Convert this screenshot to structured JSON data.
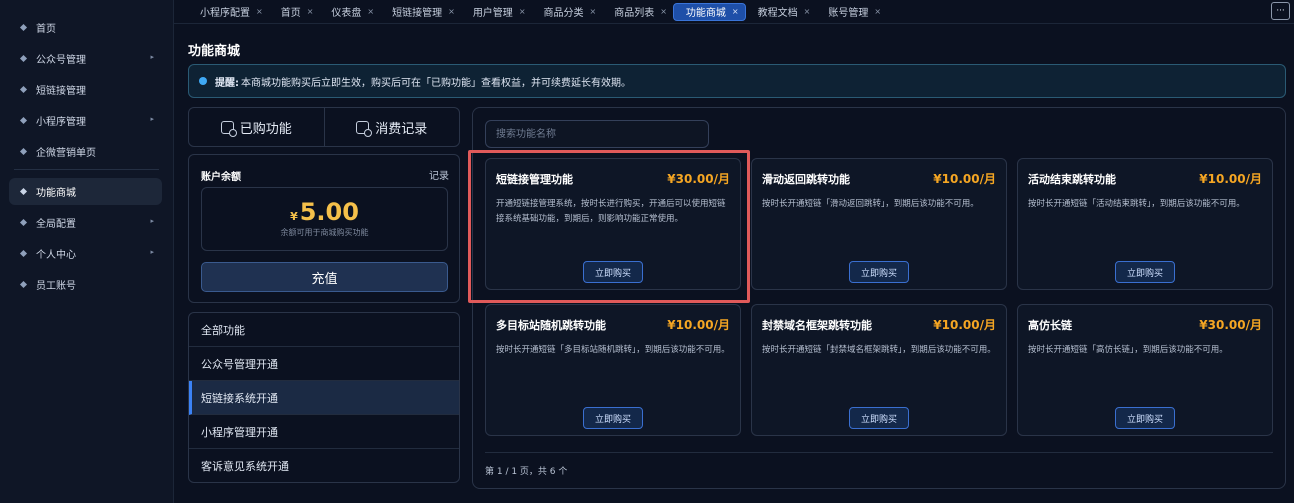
{
  "sidebar": {
    "items": [
      {
        "label": "首页",
        "arrow": false,
        "active": false
      },
      {
        "label": "公众号管理",
        "arrow": true,
        "active": false
      },
      {
        "label": "短链接管理",
        "arrow": false,
        "active": false
      },
      {
        "label": "小程序管理",
        "arrow": true,
        "active": false
      },
      {
        "label": "企微营销单页",
        "arrow": false,
        "active": false
      },
      {
        "label": "功能商城",
        "arrow": false,
        "active": true
      },
      {
        "label": "全局配置",
        "arrow": true,
        "active": false
      },
      {
        "label": "个人中心",
        "arrow": true,
        "active": false
      },
      {
        "label": "员工账号",
        "arrow": false,
        "active": false
      }
    ]
  },
  "tabs": [
    {
      "label": "小程序配置"
    },
    {
      "label": "首页"
    },
    {
      "label": "仪表盘"
    },
    {
      "label": "短链接管理"
    },
    {
      "label": "用户管理"
    },
    {
      "label": "商品分类"
    },
    {
      "label": "商品列表"
    },
    {
      "label": "功能商城",
      "active": true
    },
    {
      "label": "教程文档"
    },
    {
      "label": "账号管理"
    }
  ],
  "tab_close_glyph": "×",
  "more_glyph": "···",
  "page_title": "功能商城",
  "notice": {
    "prefix": "提醒:",
    "text": "本商城功能购买后立即生效，购买后可在「已购功能」查看权益，并可续费延长有效期。"
  },
  "switcher": {
    "purchased": "已购功能",
    "records": "消费记录"
  },
  "balance": {
    "title": "账户余额",
    "link": "记录",
    "currency": "¥",
    "amount": "5.00",
    "note": "余额可用于商城购买功能",
    "recharge": "充值"
  },
  "categories": [
    {
      "label": "全部功能",
      "active": false
    },
    {
      "label": "公众号管理开通",
      "active": false
    },
    {
      "label": "短链接系统开通",
      "active": true
    },
    {
      "label": "小程序管理开通",
      "active": false
    },
    {
      "label": "客诉意见系统开通",
      "active": false
    }
  ],
  "search": {
    "placeholder": "搜索功能名称"
  },
  "buy_label": "立即购买",
  "cards": [
    {
      "title": "短链接管理功能",
      "price": "¥30.00/月",
      "desc": "开通短链接管理系统，按时长进行购买，开通后可以使用短链接系统基础功能，到期后，则影响功能正常使用。"
    },
    {
      "title": "滑动返回跳转功能",
      "price": "¥10.00/月",
      "desc": "按时长开通短链「滑动返回跳转」，到期后该功能不可用。"
    },
    {
      "title": "活动结束跳转功能",
      "price": "¥10.00/月",
      "desc": "按时长开通短链「活动结束跳转」，到期后该功能不可用。"
    },
    {
      "title": "多目标站随机跳转功能",
      "price": "¥10.00/月",
      "desc": "按时长开通短链「多目标站随机跳转」，到期后该功能不可用。"
    },
    {
      "title": "封禁域名框架跳转功能",
      "price": "¥10.00/月",
      "desc": "按时长开通短链「封禁域名框架跳转」，到期后该功能不可用。"
    },
    {
      "title": "高仿长链",
      "price": "¥30.00/月",
      "desc": "按时长开通短链「高仿长链」，到期后该功能不可用。"
    }
  ],
  "pager": "第 1 / 1 页，共 6 个",
  "colors": {
    "accent": "#1e4fa8",
    "price": "#f5a623",
    "balance": "#f5c04a",
    "highlight": "#e05a5a"
  }
}
